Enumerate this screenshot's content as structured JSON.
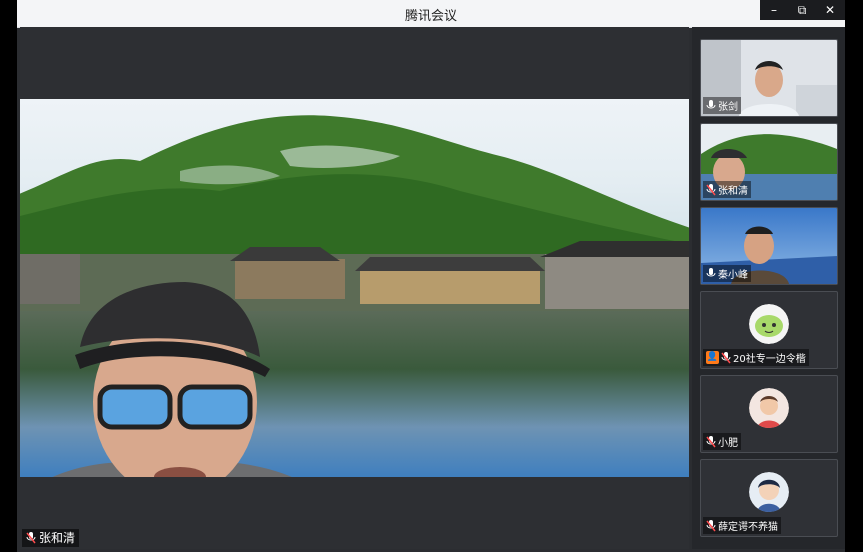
{
  "window": {
    "title": "腾讯会议",
    "controls": {
      "minimize": "–",
      "maximize": "⧉",
      "close": "✕"
    }
  },
  "main_video": {
    "speaker_name": "张和清",
    "mic_icon": "mic-muted-icon"
  },
  "participants": [
    {
      "name": "张剑",
      "mic_icon": "mic-icon",
      "type": "video"
    },
    {
      "name": "张和清",
      "mic_icon": "mic-muted-icon",
      "type": "video"
    },
    {
      "name": "秦小峰",
      "mic_icon": "mic-icon",
      "type": "video"
    },
    {
      "name": "20社专一边令楷",
      "mic_icon": "mic-muted-icon",
      "type": "avatar",
      "badge_icon": "person-badge-icon"
    },
    {
      "name": "小肥",
      "mic_icon": "mic-muted-icon",
      "type": "avatar"
    },
    {
      "name": "薛定谔不养猫",
      "mic_icon": "mic-muted-icon",
      "type": "avatar"
    }
  ],
  "colors": {
    "window_bg": "#2b2d31",
    "titlebar_bg": "#f4f5f7",
    "badge": "#ff7a1a"
  }
}
